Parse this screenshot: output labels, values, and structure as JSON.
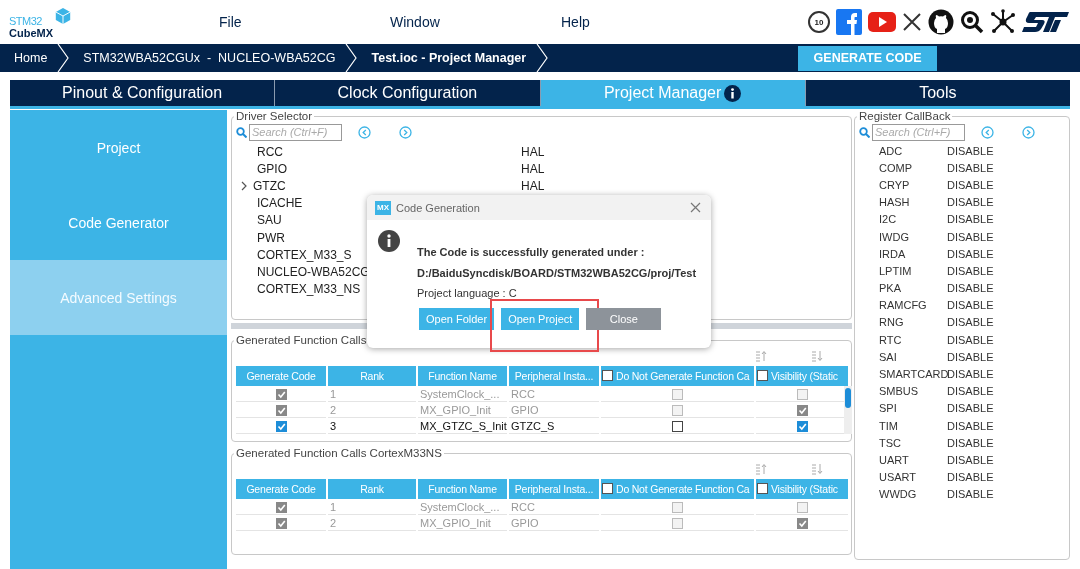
{
  "app": {
    "logo_top": "STM32",
    "logo_bottom": "CubeMX",
    "badge": "10"
  },
  "menu": [
    {
      "label": "File"
    },
    {
      "label": "Window"
    },
    {
      "label": "Help"
    }
  ],
  "breadcrumbs": [
    {
      "label": "Home",
      "current": false
    },
    {
      "label": "STM32WBA52CGUx  -  NUCLEO-WBA52CG",
      "current": false
    },
    {
      "label": "Test.ioc - Project Manager",
      "current": true
    }
  ],
  "generate_button": "GENERATE CODE",
  "tabs": [
    {
      "label": "Pinout & Configuration",
      "selected": false,
      "info": false
    },
    {
      "label": "Clock Configuration",
      "selected": false,
      "info": false
    },
    {
      "label": "Project Manager",
      "selected": true,
      "info": true
    },
    {
      "label": "Tools",
      "selected": false,
      "info": false
    }
  ],
  "sidebar": {
    "items": [
      {
        "label": "Project",
        "selected": false
      },
      {
        "label": "Code Generator",
        "selected": false
      },
      {
        "label": "Advanced Settings",
        "selected": true
      }
    ]
  },
  "driver_selector": {
    "title": "Driver Selector",
    "search": {
      "placeholder": "Search (Ctrl+F)"
    },
    "rows": [
      {
        "name": "RCC",
        "value": "HAL"
      },
      {
        "name": "GPIO",
        "value": "HAL"
      },
      {
        "name": "GTZC",
        "value": "HAL",
        "expanded": false
      },
      {
        "name": "ICACHE"
      },
      {
        "name": "SAU"
      },
      {
        "name": "PWR"
      },
      {
        "name": "CORTEX_M33_S"
      },
      {
        "name": "NUCLEO-WBA52CG"
      },
      {
        "name": "CORTEX_M33_NS"
      }
    ]
  },
  "function_tables": [
    {
      "title": "Generated Function Calls",
      "scrollable": true,
      "columns": [
        {
          "label": "Generate Code"
        },
        {
          "label": "Rank"
        },
        {
          "label": "Function Name"
        },
        {
          "label": "Peripheral Insta..."
        },
        {
          "label": "Do Not Generate Function Ca",
          "checked": false
        },
        {
          "label": "Visibility (Static",
          "checked": false
        }
      ],
      "rows": [
        {
          "generate": true,
          "rank": "1",
          "function": "SystemClock_...",
          "peripheral": "RCC",
          "no_generate": false,
          "visibility": false,
          "disabled": true
        },
        {
          "generate": true,
          "rank": "2",
          "function": "MX_GPIO_Init",
          "peripheral": "GPIO",
          "no_generate": false,
          "visibility": true,
          "disabled": true
        },
        {
          "generate": true,
          "rank": "3",
          "function": "MX_GTZC_S_Init",
          "peripheral": "GTZC_S",
          "no_generate": false,
          "visibility": true,
          "disabled": false
        }
      ]
    },
    {
      "title": "Generated Function Calls CortexM33NS",
      "scrollable": false,
      "columns": [
        {
          "label": "Generate Code"
        },
        {
          "label": "Rank"
        },
        {
          "label": "Function Name"
        },
        {
          "label": "Peripheral Insta..."
        },
        {
          "label": "Do Not Generate Function Ca",
          "checked": false
        },
        {
          "label": "Visibility (Static",
          "checked": false
        }
      ],
      "rows": [
        {
          "generate": true,
          "rank": "1",
          "function": "SystemClock_...",
          "peripheral": "RCC",
          "no_generate": false,
          "visibility": false,
          "disabled": true
        },
        {
          "generate": true,
          "rank": "2",
          "function": "MX_GPIO_Init",
          "peripheral": "GPIO",
          "no_generate": false,
          "visibility": true,
          "disabled": true
        }
      ]
    }
  ],
  "register_callback": {
    "title": "Register CallBack",
    "search": {
      "placeholder": "Search (Ctrl+F)"
    },
    "rows": [
      {
        "name": "ADC",
        "value": "DISABLE"
      },
      {
        "name": "COMP",
        "value": "DISABLE"
      },
      {
        "name": "CRYP",
        "value": "DISABLE"
      },
      {
        "name": "HASH",
        "value": "DISABLE"
      },
      {
        "name": "I2C",
        "value": "DISABLE"
      },
      {
        "name": "IWDG",
        "value": "DISABLE"
      },
      {
        "name": "IRDA",
        "value": "DISABLE"
      },
      {
        "name": "LPTIM",
        "value": "DISABLE"
      },
      {
        "name": "PKA",
        "value": "DISABLE"
      },
      {
        "name": "RAMCFG",
        "value": "DISABLE"
      },
      {
        "name": "RNG",
        "value": "DISABLE"
      },
      {
        "name": "RTC",
        "value": "DISABLE"
      },
      {
        "name": "SAI",
        "value": "DISABLE"
      },
      {
        "name": "SMARTCARD",
        "value": "DISABLE"
      },
      {
        "name": "SMBUS",
        "value": "DISABLE"
      },
      {
        "name": "SPI",
        "value": "DISABLE"
      },
      {
        "name": "TIM",
        "value": "DISABLE"
      },
      {
        "name": "TSC",
        "value": "DISABLE"
      },
      {
        "name": "UART",
        "value": "DISABLE"
      },
      {
        "name": "USART",
        "value": "DISABLE"
      },
      {
        "name": "WWDG",
        "value": "DISABLE"
      }
    ]
  },
  "dialog": {
    "title": "Code Generation",
    "badge": "MX",
    "lines": [
      {
        "text": "The Code is successfully generated under :",
        "bold": true
      },
      {
        "text": "D:/BaiduSyncdisk/BOARD/STM32WBA52CG/proj/Test",
        "bold": true
      },
      {
        "text": "Project language : C",
        "bold": false
      }
    ],
    "buttons": [
      {
        "label": "Open Folder",
        "kind": "primary",
        "highlighted": false
      },
      {
        "label": "Open Project",
        "kind": "primary",
        "highlighted": true
      },
      {
        "label": "Close",
        "kind": "secondary",
        "highlighted": false
      }
    ]
  }
}
